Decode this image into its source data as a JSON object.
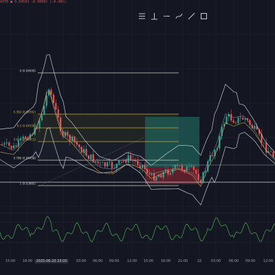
{
  "header": {
    "ohlc_text": "4378  ■ 0.04599  −0.00003  (−0.48%)"
  },
  "toolbar": {
    "buttons": [
      {
        "name": "horizontal-lines-icon",
        "glyph": "≡"
      },
      {
        "name": "vertical-ray-icon",
        "glyph": "⊥"
      },
      {
        "name": "minus-icon",
        "glyph": "−"
      },
      {
        "name": "brush-icon",
        "glyph": "⤻"
      },
      {
        "name": "trendline-icon",
        "glyph": "╱"
      },
      {
        "name": "rectangle-icon",
        "glyph": "□"
      }
    ]
  },
  "fib_levels": [
    {
      "label": "0 (0.04690)",
      "price": 0.0469
    },
    {
      "label": "0.382 (0.04582)",
      "price": 0.04582
    },
    {
      "label": "0.5 (0.04550)",
      "price": 0.0455
    },
    {
      "label": "0.618 (0.04515)",
      "price": 0.04515
    },
    {
      "label": "0.786 (0.04458)",
      "price": 0.04458
    },
    {
      "label": "1 (0.03885)",
      "price": 0.03885
    }
  ],
  "time_axis": {
    "labels": [
      "15:00",
      "18:00",
      "2025-06-20  23:00",
      "03:00",
      "06:00",
      "09:00",
      "12:00",
      "15:00",
      "18:00",
      "21:00",
      "22",
      "03:00",
      "06:00",
      "09:00",
      "12:00"
    ],
    "cursor_label": "2025-06-20  23:00"
  },
  "colors": {
    "background": "#141722",
    "up_candle": "#26a69a",
    "down_candle": "#ef5350",
    "bollinger": "#c5c8d0",
    "ma": "#d4a84b",
    "fib_line": "#d5d5c5",
    "fib_gold": "#c8a93e",
    "fib_fill": "#2a2f24",
    "long_target": "#1f5f57",
    "long_stop": "#6d2330",
    "rsi_line": "#4caf50"
  }
}
